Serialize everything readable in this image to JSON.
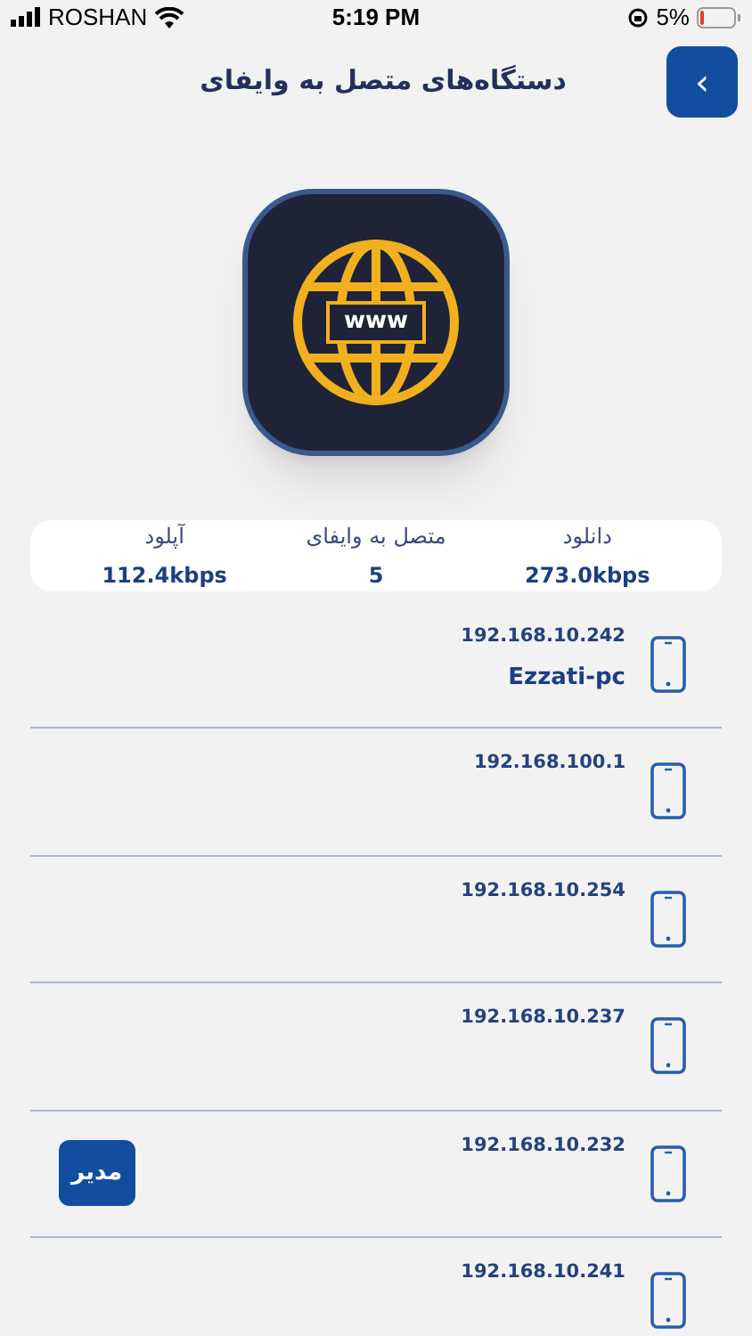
{
  "status_bar": {
    "carrier": "ROSHAN",
    "time": "5:19 PM",
    "battery": "5%"
  },
  "header": {
    "title": "دستگاه‌های متصل به وایفای",
    "back_label": "›"
  },
  "app_icon": {
    "text": "www"
  },
  "stats": {
    "download": {
      "label": "دانلود",
      "value": "273.0kbps"
    },
    "connected": {
      "label": "متصل به وایفای",
      "value": "5"
    },
    "upload": {
      "label": "آپلود",
      "value": "112.4kbps"
    }
  },
  "devices": [
    {
      "ip": "192.168.10.242",
      "name": "Ezzati-pc"
    },
    {
      "ip": "192.168.100.1"
    },
    {
      "ip": "192.168.10.254"
    },
    {
      "ip": "192.168.10.237"
    },
    {
      "ip": "192.168.10.232",
      "badge": "مدیر"
    },
    {
      "ip": "192.168.10.241"
    }
  ]
}
